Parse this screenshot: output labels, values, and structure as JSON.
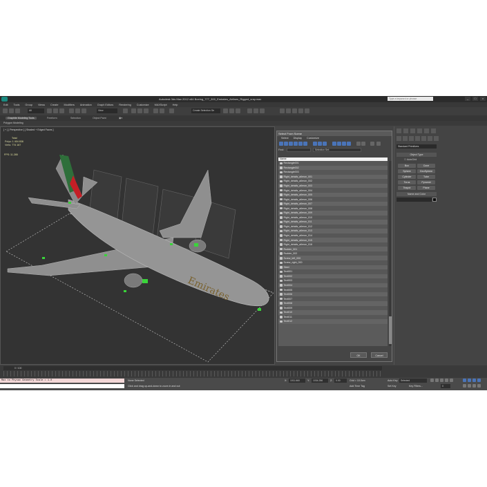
{
  "titlebar": {
    "title": "Autodesk 3ds Max  2012 x64     Boeing_777_300_Emirates_Airlines_Rigged_vray.max",
    "search_placeholder": "Type a keyword or phrase",
    "win_minimize": "_",
    "win_maximize": "□",
    "win_close": "×"
  },
  "menu": [
    "Edit",
    "Tools",
    "Group",
    "Views",
    "Create",
    "Modifiers",
    "Animation",
    "Graph Editors",
    "Rendering",
    "Customize",
    "MAXScript",
    "Help"
  ],
  "toolbar": {
    "filter_all": "All",
    "view": "View",
    "create_selection_set": "Create Selection Se"
  },
  "ribbon": {
    "tabs": [
      "Graphite Modeling Tools",
      "Freeform",
      "Selection",
      "Object Paint"
    ],
    "sub_label": "Polygon Modeling"
  },
  "viewport": {
    "label": "[ + ] [ Perspective ] [ Shaded + Edged Faces ]",
    "total_label": "Total",
    "polys_label": "Polys:",
    "polys_value": "1 404 838",
    "verts_label": "Verts:",
    "verts_value": "774 167",
    "fps_label": "FPS:",
    "fps_value": "11.285"
  },
  "dialog": {
    "title": "Select From Scene",
    "menu": [
      "Select",
      "Display",
      "Customize"
    ],
    "find_label": "Find:",
    "selection_set_label": "Selection Set:",
    "column_name": "Name",
    "rows": [
      "Rectangle001",
      "Rectangle002",
      "Rectangle003",
      "Right_details_aileron_001",
      "Right_details_aileron_002",
      "Right_details_aileron_003",
      "Right_details_aileron_004",
      "Right_details_aileron_005",
      "Right_details_aileron_006",
      "Right_details_aileron_007",
      "Right_details_aileron_008",
      "Right_details_aileron_009",
      "Right_details_aileron_010",
      "Right_details_aileron_011",
      "Right_details_aileron_012",
      "Right_details_aileron_013",
      "Right_details_aileron_014",
      "Right_details_aileron_015",
      "Right_details_aileron_016",
      "Rudder_001",
      "Rudder_002",
      "Screw_left_000",
      "Screw_right_000",
      "Steel",
      "Text001",
      "Text002",
      "Text003",
      "Text004",
      "Text005",
      "Text006",
      "Text007",
      "Text008",
      "Text009",
      "Text010",
      "Text011",
      "Text012"
    ],
    "ok": "OK",
    "cancel": "Cancel"
  },
  "command_panel": {
    "dropdown": "Standard Primitives",
    "object_type_title": "Object Type",
    "autogrid": "AutoGrid",
    "primitives": [
      "Box",
      "Cone",
      "Sphere",
      "GeoSphere",
      "Cylinder",
      "Tube",
      "Torus",
      "Pyramid",
      "Teapot",
      "Plane"
    ],
    "name_color_title": "Name and Color"
  },
  "timeline": {
    "frame_label": "0 / 100"
  },
  "status": {
    "script_line1": "Max to Physac Geometry Scale = 1.0",
    "script_line2": "",
    "selection": "None Selected",
    "prompt": "Click and drag up-and-down to zoom in and out",
    "x_label": "X:",
    "x_value": "1011.660",
    "y_label": "Y:",
    "y_value": "1034.256",
    "z_label": "Z:",
    "z_value": "0.00",
    "grid": "Grid = 10.0cm",
    "add_time_tag": "Add Time Tag",
    "auto_key": "Auto Key",
    "auto_key_value": "Selected",
    "set_key": "Set Key",
    "key_filters": "Key Filters...",
    "frame_value": "0"
  },
  "colors": {
    "accent_blue": "#4a74b8",
    "viewport_bg": "#333333",
    "wire_green": "#3ad43a"
  }
}
